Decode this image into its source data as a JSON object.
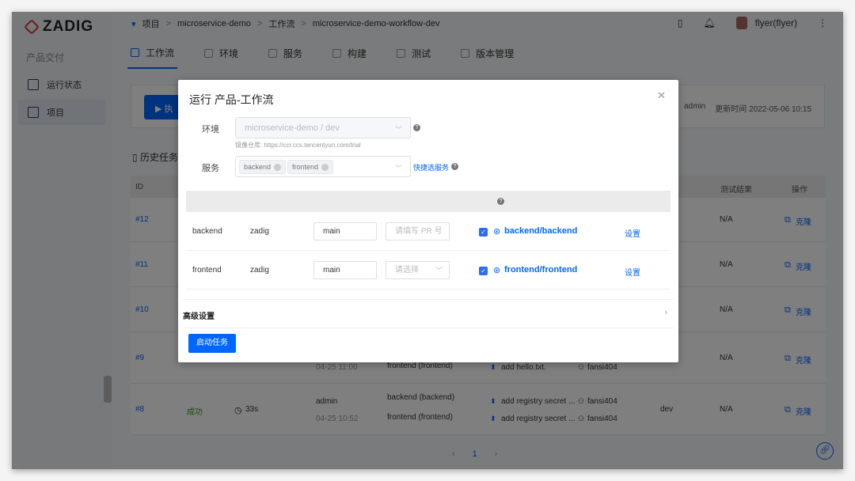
{
  "app": {
    "logo": "ZADIG",
    "group": "产品交付",
    "nav": [
      {
        "label": "运行状态"
      },
      {
        "label": "项目"
      }
    ]
  },
  "breadcrumb": [
    "项目",
    "microservice-demo",
    "工作流",
    "microservice-demo-workflow-dev"
  ],
  "user": "flyer(flyer)",
  "tabs": [
    "工作流",
    "环境",
    "服务",
    "构建",
    "测试",
    "版本管理"
  ],
  "card": {
    "run_label": "执",
    "creator": "admin",
    "updated_label": "更新时间",
    "updated": "2022-05-06 10:15"
  },
  "history_title": "历史任务",
  "table": {
    "headers": {
      "id": "ID",
      "test": "测试结果",
      "ops": "操作"
    },
    "rows": [
      {
        "id": "#12",
        "test": "N/A",
        "op": "克隆"
      },
      {
        "id": "#11",
        "test": "N/A",
        "op": "克隆"
      },
      {
        "id": "#10",
        "test": "N/A",
        "op": "克隆"
      },
      {
        "id": "#9",
        "time": "04-25 11:00",
        "service2": "frontend (frontend)",
        "commit2": "add hello.txt.",
        "author2": "fansi404",
        "test": "N/A",
        "op": "克隆"
      },
      {
        "id": "#8",
        "status": "成功",
        "duration": "33s",
        "creator": "admin",
        "time": "04-25 10:52",
        "service1": "backend (backend)",
        "service2": "frontend (frontend)",
        "commit1": "add registry secret ...",
        "commit2": "add registry secret ...",
        "author1": "fansi404",
        "author2": "fansi404",
        "env": "dev",
        "test": "N/A",
        "op": "克隆"
      }
    ]
  },
  "pagination": {
    "page": "1"
  },
  "modal": {
    "title": "运行 产品-工作流",
    "env_label": "环境",
    "env_value": "microservice-demo / dev",
    "registry": "镜像仓库: https://ccr.ccs.tencentyun.com/trial",
    "service_label": "服务",
    "tags": [
      "backend",
      "frontend"
    ],
    "quick_select": "快捷选服务",
    "services": [
      {
        "name": "backend",
        "owner": "zadig",
        "branch": "main",
        "pr_placeholder": "请填写 PR 号",
        "repo": "backend/backend",
        "settings": "设置"
      },
      {
        "name": "frontend",
        "owner": "zadig",
        "branch": "main",
        "pr_placeholder": "请选择",
        "repo": "frontend/frontend",
        "settings": "设置"
      }
    ],
    "advanced": "高级设置",
    "start": "启动任务"
  },
  "colors": {
    "accent": "#0066ff",
    "success": "#3a9a1a"
  }
}
